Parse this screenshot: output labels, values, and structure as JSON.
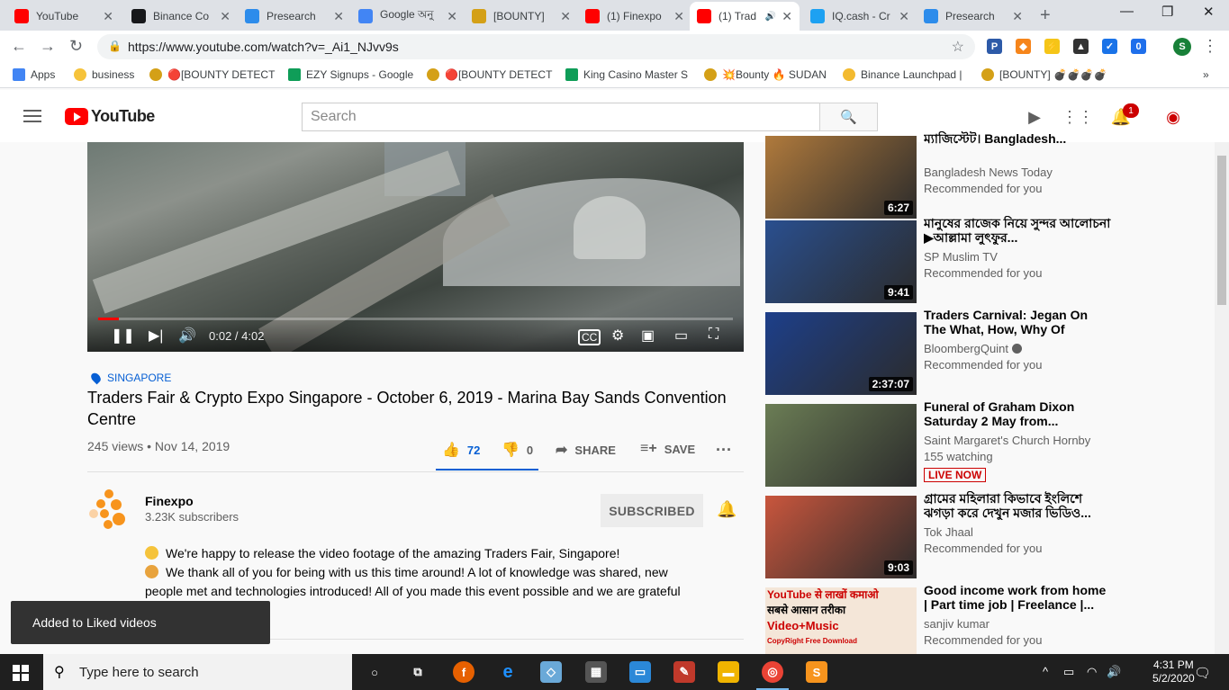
{
  "browser": {
    "tabs": [
      {
        "title": "YouTube",
        "icon": "youtube-icon",
        "color": "#ff0000"
      },
      {
        "title": "Binance Co",
        "icon": "coinmarketcap-icon",
        "color": "#17181b"
      },
      {
        "title": "Presearch",
        "icon": "presearch-icon",
        "color": "#2d8ceb"
      },
      {
        "title": "Google অনু",
        "icon": "google-translate-icon",
        "color": "#4285f4"
      },
      {
        "title": "[BOUNTY]",
        "icon": "bitcointalk-icon",
        "color": "#d4a017"
      },
      {
        "title": "(1) Finexpo",
        "icon": "youtube-icon",
        "color": "#ff0000"
      },
      {
        "title": "(1) Trad",
        "icon": "youtube-icon",
        "color": "#ff0000"
      },
      {
        "title": "IQ.cash - Cr",
        "icon": "twitter-icon",
        "color": "#1da1f2"
      },
      {
        "title": "Presearch",
        "icon": "presearch-icon",
        "color": "#2d8ceb"
      }
    ],
    "url": "https://www.youtube.com/watch?v=_Ai1_NJvv9s",
    "bookmarks": [
      {
        "label": "Apps",
        "color": "#4285f4"
      },
      {
        "label": "business",
        "color": "#f6c33b"
      },
      {
        "label": "🔴[BOUNTY DETECT",
        "color": "#d4a017"
      },
      {
        "label": "EZY Signups - Google",
        "color": "#0f9d58"
      },
      {
        "label": "🔴[BOUNTY DETECT",
        "color": "#d4a017"
      },
      {
        "label": "King Casino Master S",
        "color": "#0f9d58"
      },
      {
        "label": "💥Bounty 🔥 SUDAN",
        "color": "#d4a017"
      },
      {
        "label": "Binance Launchpad |",
        "color": "#f3ba2f"
      },
      {
        "label": "[BOUNTY] 💣💣💣💣",
        "color": "#d4a017"
      }
    ],
    "profile_initial": "S"
  },
  "youtube": {
    "logo_text": "YouTube",
    "search_placeholder": "Search",
    "notification_count": "1",
    "player": {
      "time": "0:02 / 4:02",
      "progress_fraction": 0.008
    },
    "location": "SINGAPORE",
    "title": "Traders Fair & Crypto Expo Singapore - October 6, 2019 - Marina Bay Sands Convention Centre",
    "meta": "245 views • Nov 14, 2019",
    "likes": "72",
    "dislikes": "0",
    "share_label": "SHARE",
    "save_label": "SAVE",
    "channel": {
      "name": "Finexpo",
      "subscribers": "3.23K subscribers",
      "subscribe_label": "SUBSCRIBED"
    },
    "description": [
      "We're happy to release the video footage of the amazing Traders Fair, Singapore!",
      "We thank all of you for being with us this time around! A lot of knowledge was shared, new",
      "people met and technologies introduced! All of you made this event possible and we are grateful"
    ],
    "toast": "Added to Liked videos",
    "related": [
      {
        "title": "ম্যাজিস্টেট। Bangladesh...",
        "channel": "Bangladesh News Today",
        "sub": "Recommended for you",
        "duration": "6:27",
        "verified": false,
        "live": false,
        "thumb": "#b07a3c"
      },
      {
        "title": "মানুষের রাজেক নিয়ে সুন্দর আলোচনা ▶আল্লামা লুৎফুর...",
        "channel": "SP Muslim TV",
        "sub": "Recommended for you",
        "duration": "9:41",
        "verified": false,
        "live": false,
        "thumb": "#2a4f8f"
      },
      {
        "title": "Traders Carnival: Jegan On The What, How, Why Of Options...",
        "channel": "BloombergQuint",
        "sub": "Recommended for you",
        "duration": "2:37:07",
        "verified": true,
        "live": false,
        "thumb": "#1d3f8a"
      },
      {
        "title": "Funeral of Graham Dixon Saturday 2 May from...",
        "channel": "Saint Margaret's Church Hornby",
        "sub": "155 watching",
        "duration": "",
        "verified": false,
        "live": true,
        "live_label": "LIVE NOW",
        "thumb": "#6b7d55"
      },
      {
        "title": "গ্রামের মহিলারা কিভাবে ইংলিশে ঝগড়া করে দেখুন মজার ভিডিও...",
        "channel": "Tok Jhaal",
        "sub": "Recommended for you",
        "duration": "9:03",
        "verified": false,
        "live": false,
        "thumb": "#c9563d"
      },
      {
        "title": "Good income work from home | Part time job | Freelance |...",
        "channel": "sanjiv kumar",
        "sub": "Recommended for you",
        "duration": "",
        "verified": false,
        "live": false,
        "thumb": "#f4e6d8",
        "thumb_text": [
          "YouTube से लाखों कमाओ",
          "सबसे आसान तरीका",
          "Video+Music",
          "CopyRight Free Download"
        ]
      }
    ]
  },
  "taskbar": {
    "search_placeholder": "Type here to search",
    "time": "4:31 PM",
    "date": "5/2/2020"
  }
}
